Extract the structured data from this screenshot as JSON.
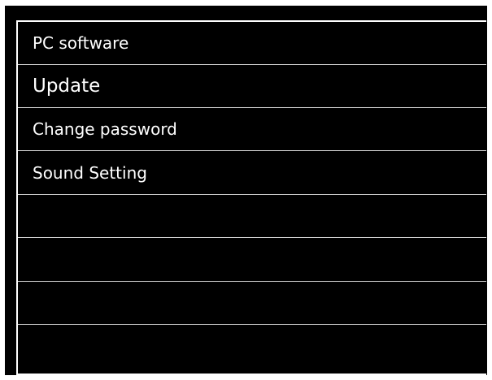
{
  "menu": {
    "items": [
      {
        "label": "PC software"
      },
      {
        "label": "Update"
      },
      {
        "label": "Change password"
      },
      {
        "label": "Sound Setting"
      },
      {
        "label": ""
      },
      {
        "label": ""
      },
      {
        "label": ""
      },
      {
        "label": ""
      }
    ],
    "selected_label": "Update"
  }
}
